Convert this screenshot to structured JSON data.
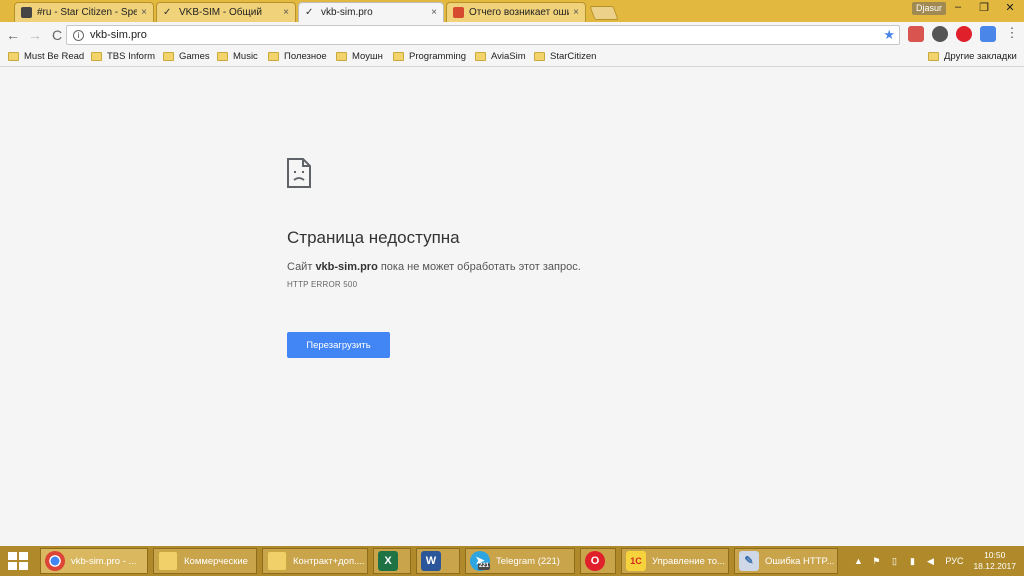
{
  "tabs": [
    {
      "title": "#ru - Star Citizen - Spect",
      "close": "×"
    },
    {
      "title": "VKB-SIM - Общий",
      "close": "×"
    },
    {
      "title": "vkb-sim.pro",
      "close": "×"
    },
    {
      "title": "Отчего возникает ошиб",
      "close": "×"
    }
  ],
  "window": {
    "user": "Djasur",
    "minimize": "–",
    "maximize": "❐",
    "close": "✕"
  },
  "toolbar": {
    "back": "←",
    "forward": "→",
    "reload": "C",
    "url": "vkb-sim.pro",
    "star": "★",
    "info": "i"
  },
  "bookmarks": [
    {
      "label": "Must Be Read"
    },
    {
      "label": "TBS Inform"
    },
    {
      "label": "Games"
    },
    {
      "label": "Music"
    },
    {
      "label": "Полезное"
    },
    {
      "label": "Моушн"
    },
    {
      "label": "Programming"
    },
    {
      "label": "AviaSim"
    },
    {
      "label": "StarCitizen"
    }
  ],
  "other_bookmarks": "Другие закладки",
  "error": {
    "title": "Страница недоступна",
    "msg_prefix": "Сайт ",
    "msg_site": "vkb-sim.pro",
    "msg_suffix": " пока не может обработать этот запрос.",
    "code": "HTTP ERROR 500",
    "reload_button": "Перезагрузить"
  },
  "taskbar": {
    "items": [
      {
        "label": "vkb-sim.pro - ..."
      },
      {
        "label": "Коммерческие"
      },
      {
        "label": "Контракт+доп...."
      },
      {
        "label": ""
      },
      {
        "label": ""
      },
      {
        "label": "Telegram (221)"
      },
      {
        "label": ""
      },
      {
        "label": "Управление то..."
      },
      {
        "label": "Ошибка HTTP..."
      }
    ],
    "badge": "221",
    "lang": "РУС",
    "time": "10:50",
    "date": "18.12.2017"
  },
  "colors": {
    "accent_blue": "#4285f4",
    "taskbar": "#b08a2a",
    "tabstrip": "#e3b83f"
  }
}
